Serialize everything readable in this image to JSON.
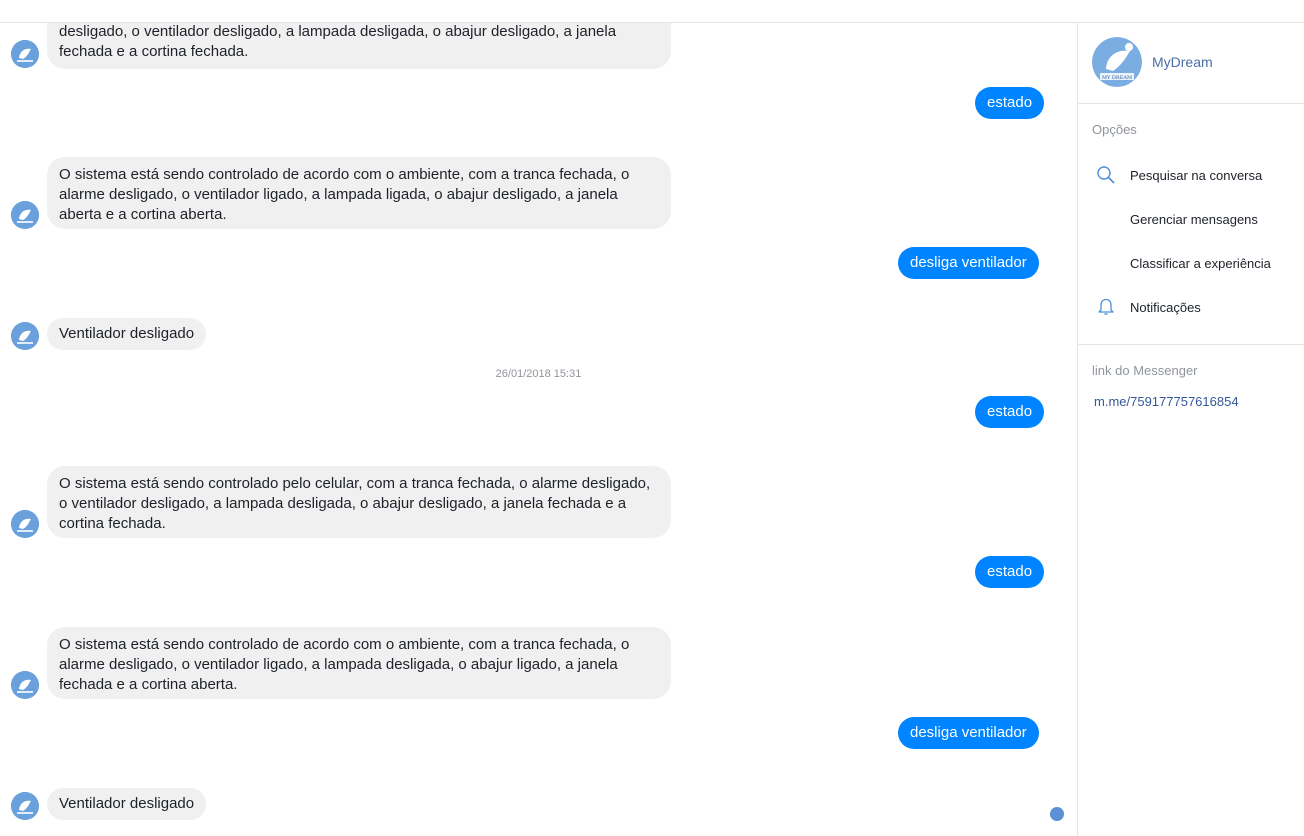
{
  "bot": {
    "name": "MyDream",
    "logo_text": "MY DREAM"
  },
  "messages": [
    {
      "type": "in",
      "text": "desligado, o ventilador desligado, a lampada desligada, o abajur desligado, a janela fechada e a cortina fechada."
    },
    {
      "type": "out",
      "text": "estado"
    },
    {
      "type": "in",
      "text": "O sistema está sendo controlado de acordo com o ambiente, com a tranca fechada, o alarme desligado, o ventilador ligado, a lampada ligada, o abajur desligado, a janela aberta e a cortina aberta."
    },
    {
      "type": "out",
      "text": "desliga ventilador"
    },
    {
      "type": "in",
      "text": "Ventilador desligado"
    },
    {
      "type": "timestamp",
      "text": "26/01/2018 15:31"
    },
    {
      "type": "out",
      "text": "estado"
    },
    {
      "type": "in",
      "text": "O sistema está sendo controlado pelo celular, com a tranca fechada, o alarme desligado, o ventilador desligado, a lampada desligada, o abajur desligado, a janela fechada e a cortina fechada."
    },
    {
      "type": "out",
      "text": "estado"
    },
    {
      "type": "in",
      "text": "O sistema está sendo controlado de acordo com o ambiente, com a tranca fechada, o alarme desligado, o ventilador ligado, a lampada desligada, o abajur ligado, a janela fechada e a cortina aberta."
    },
    {
      "type": "out",
      "text": "desliga ventilador"
    },
    {
      "type": "in",
      "text": "Ventilador desligado"
    }
  ],
  "sidebar": {
    "options_label": "Opções",
    "options": [
      {
        "label": "Pesquisar na conversa",
        "icon": "search-icon"
      },
      {
        "label": "Gerenciar mensagens",
        "icon": ""
      },
      {
        "label": "Classificar a experiência",
        "icon": ""
      },
      {
        "label": "Notificações",
        "icon": "bell-icon"
      }
    ],
    "link_label": "link do Messenger",
    "link": "m.me/759177757616854"
  },
  "colors": {
    "outgoing_bubble": "#0084ff",
    "incoming_bubble": "#f1f0f0",
    "avatar": "#4a90d9",
    "link": "#365899"
  }
}
